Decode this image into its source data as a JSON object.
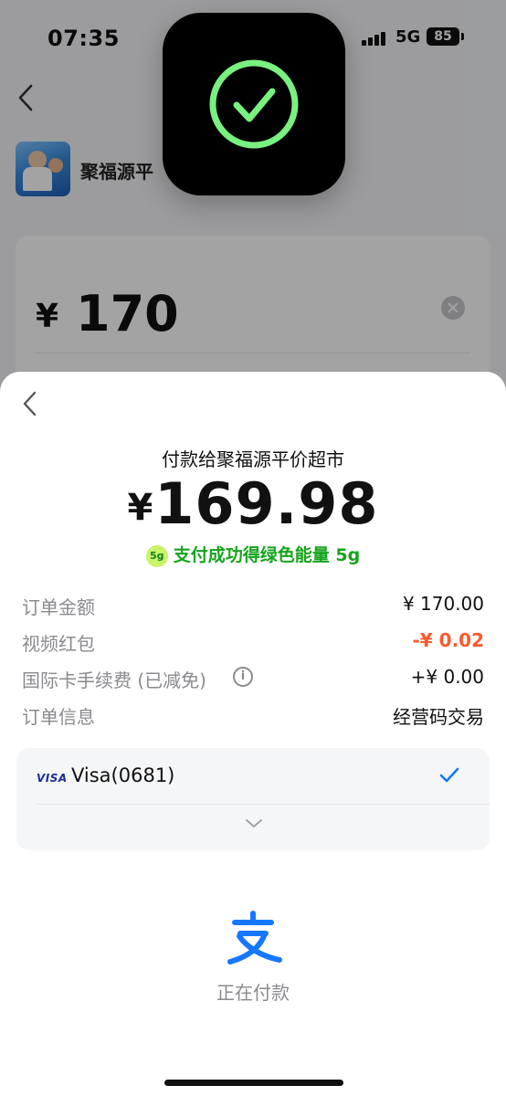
{
  "status_bar": {
    "time": "07:35",
    "network": "5G",
    "battery": "85"
  },
  "background": {
    "merchant_name": "聚福源平",
    "amount_currency": "¥",
    "amount_value": "170"
  },
  "toast": {
    "icon": "checkmark-circle-icon",
    "accent_color": "#79f07f"
  },
  "sheet": {
    "pay_to": "付款给聚福源平价超市",
    "currency": "¥",
    "amount": "169.98",
    "energy_badge": "5g",
    "energy_text": "支付成功得绿色能量 5g",
    "rows": [
      {
        "label": "订单金额",
        "value": "¥ 170.00"
      },
      {
        "label": "视频红包",
        "value": "-¥ 0.02"
      },
      {
        "label": "国际卡手续费 (已减免)",
        "value": "+¥ 0.00"
      },
      {
        "label": "订单信息",
        "value": "经营码交易"
      }
    ],
    "payment_method": {
      "brand": "VISA",
      "label": "Visa(0681)"
    },
    "status": "正在付款"
  },
  "colors": {
    "discount_red": "#ff5a2c",
    "energy_green": "#16a31d",
    "check_blue": "#1677ff"
  }
}
